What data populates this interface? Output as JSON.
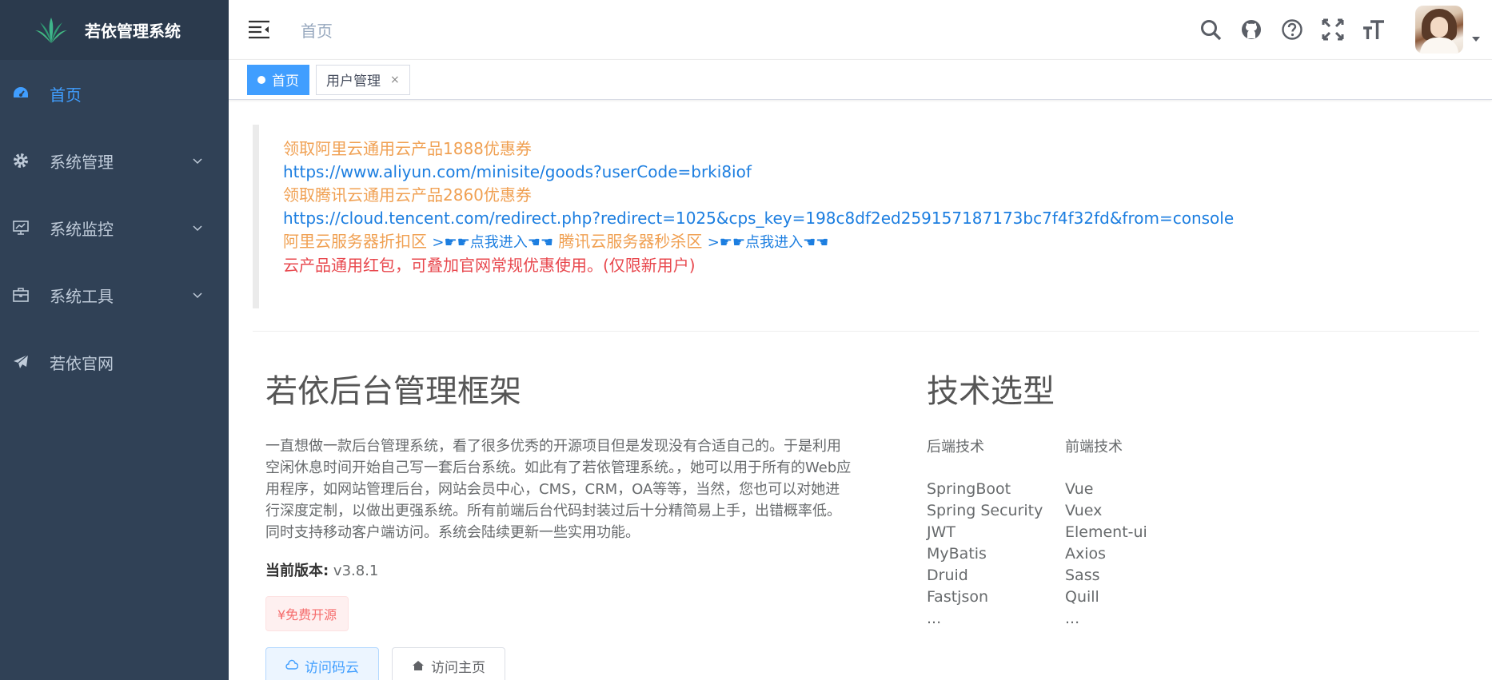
{
  "app": {
    "title": "若依管理系统"
  },
  "sidebar": {
    "items": [
      {
        "label": "首页",
        "icon": "dashboard-icon",
        "active": true
      },
      {
        "label": "系统管理",
        "icon": "gear-icon",
        "expandable": true
      },
      {
        "label": "系统监控",
        "icon": "monitor-icon",
        "expandable": true
      },
      {
        "label": "系统工具",
        "icon": "toolbox-icon",
        "expandable": true
      },
      {
        "label": "若依官网",
        "icon": "send-icon"
      }
    ]
  },
  "header": {
    "breadcrumb": "首页",
    "icons": [
      "search-icon",
      "github-icon",
      "help-icon",
      "fullscreen-icon",
      "font-size-icon"
    ]
  },
  "tags": {
    "items": [
      {
        "label": "首页",
        "active": true
      },
      {
        "label": "用户管理",
        "close": "×"
      }
    ]
  },
  "notice": {
    "line1": "领取阿里云通用云产品1888优惠券",
    "line2": "https://www.aliyun.com/minisite/goods?userCode=brki8iof",
    "line3": "领取腾讯云通用云产品2860优惠券",
    "line4": "https://cloud.tencent.com/redirect.php?redirect=1025&cps_key=198c8df2ed259157187173bc7f4f32fd&from=console",
    "line5a": "阿里云服务器折扣区 ",
    "line5b": ">☛☛点我进入☚☚",
    "line5c": " 腾讯云服务器秒杀区 ",
    "line5d": ">☛☛点我进入☚☚",
    "line6": "云产品通用红包，可叠加官网常规优惠使用。(仅限新用户)"
  },
  "intro": {
    "title": "若依后台管理框架",
    "description": "一直想做一款后台管理系统，看了很多优秀的开源项目但是发现没有合适自己的。于是利用空闲休息时间开始自己写一套后台系统。如此有了若依管理系统。，她可以用于所有的Web应用程序，如网站管理后台，网站会员中心，CMS，CRM，OA等等，当然，您也可以对她进行深度定制，以做出更强系统。所有前端后台代码封装过后十分精简易上手，出错概率低。同时支持移动客户端访问。系统会陆续更新一些实用功能。",
    "version_label": "当前版本:",
    "version_value": " v3.8.1",
    "free_tag": "¥免费开源",
    "btn_gitee": "访问码云",
    "btn_home": "访问主页"
  },
  "tech": {
    "title": "技术选型",
    "backend_header": "后端技术",
    "frontend_header": "前端技术",
    "backend": [
      "SpringBoot",
      "Spring Security",
      "JWT",
      "MyBatis",
      "Druid",
      "Fastjson",
      "..."
    ],
    "frontend": [
      "Vue",
      "Vuex",
      "Element-ui",
      "Axios",
      "Sass",
      "Quill",
      "..."
    ]
  },
  "colors": {
    "sidebar_bg": "#304156",
    "accent": "#409eff",
    "notice_orange": "#f0a052",
    "notice_blue": "#1c7ee0",
    "notice_red": "#e8484e"
  }
}
